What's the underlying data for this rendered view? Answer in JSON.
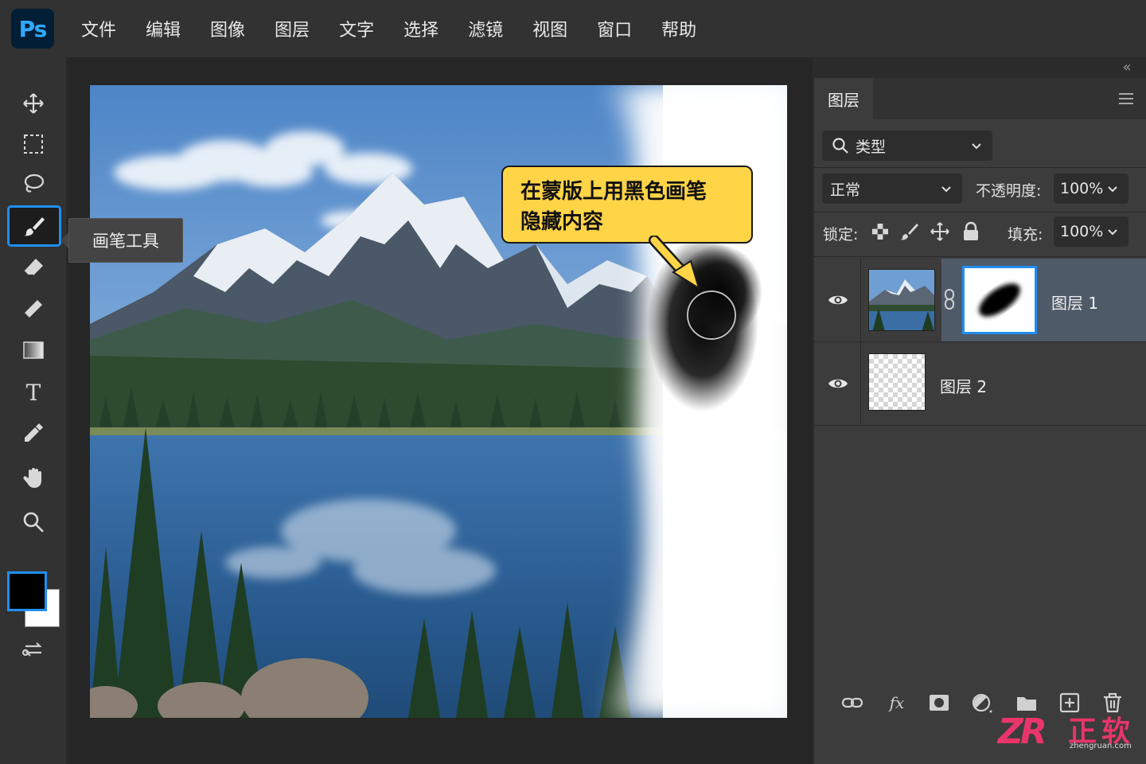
{
  "app": {
    "logo": "Ps"
  },
  "menu": [
    "文件",
    "编辑",
    "图像",
    "图层",
    "文字",
    "选择",
    "滤镜",
    "视图",
    "窗口",
    "帮助"
  ],
  "toolbar": {
    "tools": [
      "move-icon",
      "marquee-icon",
      "lasso-icon",
      "brush-icon",
      "eraser-icon",
      "ruler-icon",
      "gradient-icon",
      "type-icon",
      "eyedropper-icon",
      "hand-icon",
      "zoom-icon"
    ],
    "active_tool": "brush-icon",
    "tooltip": "画笔工具",
    "foreground_color": "#000000",
    "background_color": "#ffffff"
  },
  "canvas": {
    "callout_line1": "在蒙版上用黑色画笔",
    "callout_line2": "隐藏内容",
    "callout_color": "#ffd447"
  },
  "layers_panel": {
    "tab": "图层",
    "filter_label": "类型",
    "blend_mode": "正常",
    "opacity_label": "不透明度:",
    "opacity_value": "100%",
    "lock_label": "锁定:",
    "fill_label": "填充:",
    "fill_value": "100%",
    "layers": [
      {
        "name": "图层 1",
        "visible": true,
        "has_mask": true,
        "selected": true
      },
      {
        "name": "图层 2",
        "visible": true,
        "has_mask": false,
        "selected": false
      }
    ],
    "footer_icons": [
      "link-icon",
      "fx-icon",
      "mask-icon",
      "adjustment-icon",
      "folder-icon",
      "new-layer-icon",
      "trash-icon"
    ],
    "accent_color": "#1f8ff0"
  },
  "watermark": {
    "logo": "ZR",
    "name": "正软",
    "url": "zhengruan.com"
  }
}
